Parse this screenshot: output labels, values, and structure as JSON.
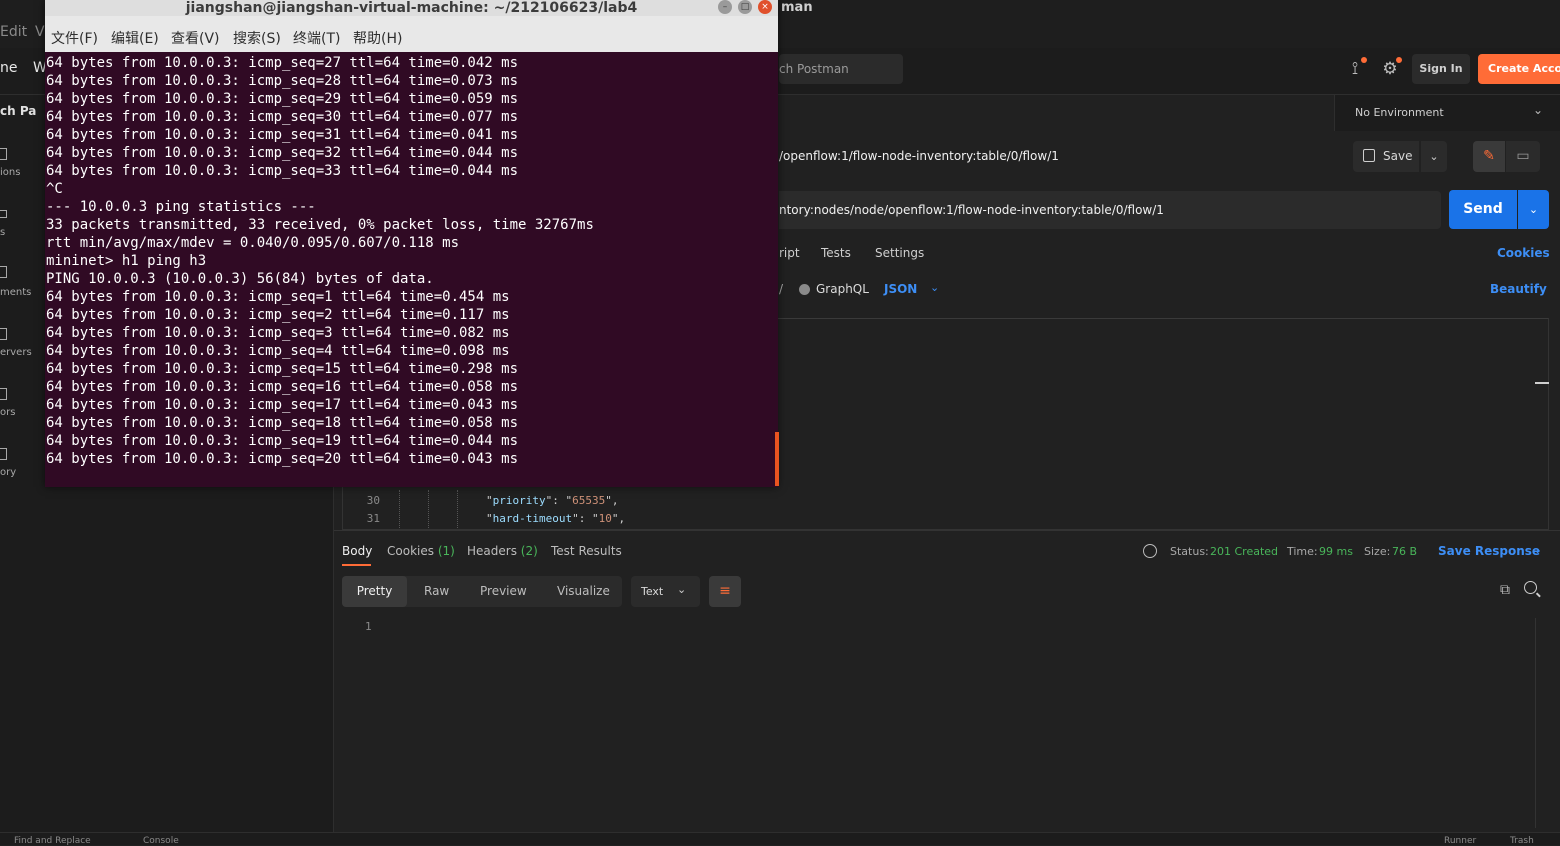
{
  "postman": {
    "title": "man",
    "menu": [
      "Edit",
      "V"
    ],
    "header": {
      "home": "ne",
      "workspace": "W",
      "search_placeholder": "ch Postman",
      "sign_in": "Sign In",
      "create_account": "Create Account"
    },
    "sidebar": {
      "scratch_pad": "ch Pad",
      "items": [
        "ions",
        "s",
        "ments",
        "ervers",
        "ors",
        "ory"
      ]
    },
    "environment": "No Environment",
    "request": {
      "name": "/openflow:1/flow-node-inventory:table/0/flow/1",
      "url": "ntory:nodes/node/openflow:1/flow-node-inventory:table/0/flow/1",
      "save_label": "Save",
      "send_label": "Send",
      "tabs": [
        "ript",
        "Tests",
        "Settings"
      ],
      "cookies_link": "Cookies",
      "body_mode": "GraphQL",
      "body_type": "JSON",
      "beautify": "Beautify",
      "slash": "/"
    },
    "editor": {
      "lines": [
        {
          "num": "30",
          "key": "priority",
          "value": "65535"
        },
        {
          "num": "31",
          "key": "hard-timeout",
          "value": "10"
        }
      ]
    },
    "response": {
      "tabs": {
        "body": "Body",
        "cookies": "Cookies",
        "cookies_count": "(1)",
        "headers": "Headers",
        "headers_count": "(2)",
        "test_results": "Test Results"
      },
      "status_label": "Status:",
      "status_value": "201 Created",
      "time_label": "Time:",
      "time_value": "99 ms",
      "size_label": "Size:",
      "size_value": "76 B",
      "save_response": "Save Response",
      "views": [
        "Pretty",
        "Raw",
        "Preview",
        "Visualize"
      ],
      "format": "Text",
      "line_number": "1"
    },
    "footer": [
      "Find and Replace",
      "Console",
      "Runner",
      "Trash"
    ]
  },
  "terminal": {
    "title": "jiangshan@jiangshan-virtual-machine: ~/212106623/lab4",
    "menu": [
      "文件(F)",
      "编辑(E)",
      "查看(V)",
      "搜索(S)",
      "终端(T)",
      "帮助(H)"
    ],
    "lines": [
      "64 bytes from 10.0.0.3: icmp_seq=27 ttl=64 time=0.042 ms",
      "64 bytes from 10.0.0.3: icmp_seq=28 ttl=64 time=0.073 ms",
      "64 bytes from 10.0.0.3: icmp_seq=29 ttl=64 time=0.059 ms",
      "64 bytes from 10.0.0.3: icmp_seq=30 ttl=64 time=0.077 ms",
      "64 bytes from 10.0.0.3: icmp_seq=31 ttl=64 time=0.041 ms",
      "64 bytes from 10.0.0.3: icmp_seq=32 ttl=64 time=0.044 ms",
      "64 bytes from 10.0.0.3: icmp_seq=33 ttl=64 time=0.044 ms",
      "^C",
      "--- 10.0.0.3 ping statistics ---",
      "33 packets transmitted, 33 received, 0% packet loss, time 32767ms",
      "rtt min/avg/max/mdev = 0.040/0.095/0.607/0.118 ms",
      "mininet> h1 ping h3",
      "PING 10.0.0.3 (10.0.0.3) 56(84) bytes of data.",
      "64 bytes from 10.0.0.3: icmp_seq=1 ttl=64 time=0.454 ms",
      "64 bytes from 10.0.0.3: icmp_seq=2 ttl=64 time=0.117 ms",
      "64 bytes from 10.0.0.3: icmp_seq=3 ttl=64 time=0.082 ms",
      "64 bytes from 10.0.0.3: icmp_seq=4 ttl=64 time=0.098 ms",
      "64 bytes from 10.0.0.3: icmp_seq=15 ttl=64 time=0.298 ms",
      "64 bytes from 10.0.0.3: icmp_seq=16 ttl=64 time=0.058 ms",
      "64 bytes from 10.0.0.3: icmp_seq=17 ttl=64 time=0.043 ms",
      "64 bytes from 10.0.0.3: icmp_seq=18 ttl=64 time=0.058 ms",
      "64 bytes from 10.0.0.3: icmp_seq=19 ttl=64 time=0.044 ms",
      "64 bytes from 10.0.0.3: icmp_seq=20 ttl=64 time=0.043 ms"
    ]
  },
  "colors": {
    "accent": "#ff6c37",
    "send": "#1a73e8",
    "link": "#3d8ef5",
    "success": "#49b55a",
    "terminal_bg": "#300a24"
  }
}
